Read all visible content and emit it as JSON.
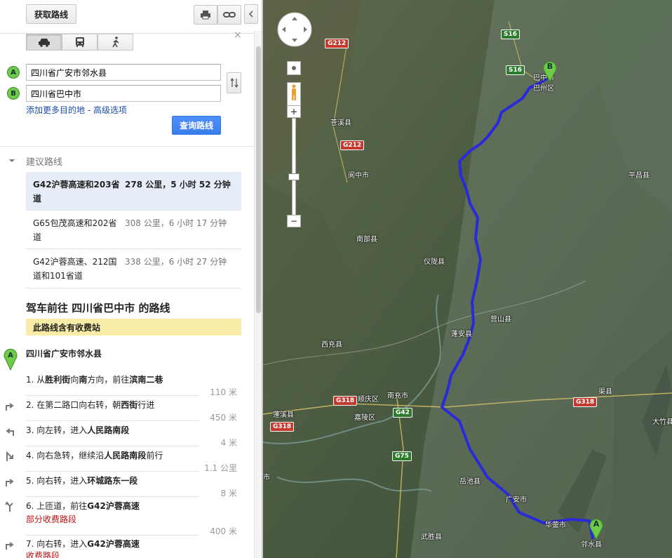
{
  "toolbar": {
    "get_directions": "获取路线"
  },
  "modes": [
    "driving",
    "transit",
    "walking"
  ],
  "route_form": {
    "start_marker": "A",
    "end_marker": "B",
    "start_value": "四川省广安市邻水县",
    "end_value": "四川省巴中市",
    "add_destination": "添加更多目的地",
    "dash": " - ",
    "advanced": "高级选项",
    "search_button": "查询路线"
  },
  "suggested": {
    "header": "建议路线",
    "routes": [
      {
        "name": "G42沪蓉高速和203省道",
        "meta": "278 公里，5 小时 52 分钟",
        "selected": true
      },
      {
        "name": "G65包茂高速和202省道",
        "meta": "308 公里，6 小时 17 分钟",
        "selected": false
      },
      {
        "name": "G42沪蓉高速、212国道和101省道",
        "meta": "338 公里，6 小时 27 分钟",
        "selected": false
      }
    ]
  },
  "directions": {
    "title": "驾车前往 四川省巴中市 的路线",
    "toll_notice": "此路线含有收费站",
    "origin": "四川省广安市邻水县",
    "steps": [
      {
        "n": "1.",
        "pre": "从",
        "b1": "胜利街",
        "mid": "向",
        "b2": "南",
        "mid2": "方向，前往",
        "b3": "滨南二巷",
        "dist": "110 米",
        "icon": "none"
      },
      {
        "n": "2.",
        "pre": "在第二路口向右转，朝",
        "b1": "西街",
        "mid": "行进",
        "dist": "450 米",
        "icon": "turn-right"
      },
      {
        "n": "3.",
        "pre": "向左转，进入",
        "b1": "人民路南段",
        "dist": "4 米",
        "icon": "turn-left"
      },
      {
        "n": "4.",
        "pre": "向右急转，继续沿",
        "b1": "人民路南段",
        "mid": "前行",
        "dist": "1.1 公里",
        "icon": "sharp-right"
      },
      {
        "n": "5.",
        "pre": "向右转，进入",
        "b1": "环城路东一段",
        "dist": "8 米",
        "icon": "turn-right"
      },
      {
        "n": "6.",
        "pre": "上匝道，前往",
        "b1": "G42沪蓉高速",
        "toll": "部分收费路段",
        "dist": "400 米",
        "icon": "ramp"
      },
      {
        "n": "7.",
        "pre": "向右转，进入",
        "b1": "G42沪蓉高速",
        "toll": "收费路段",
        "icon": "turn-right"
      }
    ]
  },
  "map": {
    "marker_a": "A",
    "marker_b": "B",
    "place_labels": [
      "巴中市",
      "巴州区",
      "苍溪县",
      "阆中市",
      "平昌县",
      "南部县",
      "仪陇县",
      "营山县",
      "蓬安县",
      "西充县",
      "南充市",
      "顺庆区",
      "嘉陵区",
      "蓬溪县",
      "渠县",
      "岳池县",
      "广安市",
      "华蓥市",
      "邻水县",
      "武胜县",
      "大竹县",
      "市"
    ],
    "road_shields": [
      "S16",
      "S16",
      "G212",
      "G212",
      "G318",
      "G318",
      "G318",
      "G42",
      "G75"
    ],
    "route_color": "#2a2ad8"
  }
}
